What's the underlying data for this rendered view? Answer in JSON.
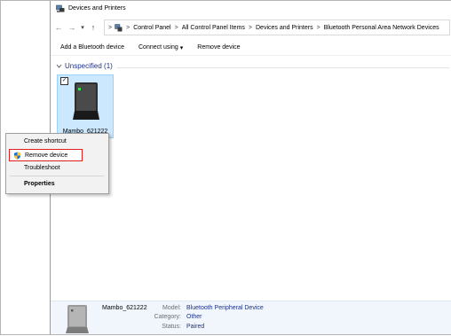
{
  "window": {
    "title": "Devices and Printers"
  },
  "address": {
    "crumbs": [
      "Control Panel",
      "All Control Panel Items",
      "Devices and Printers",
      "Bluetooth Personal Area Network Devices"
    ],
    "separator": ">"
  },
  "nav": {
    "back": "←",
    "forward": "→",
    "dropdown": "▾",
    "up": "↑",
    "crumb_arrow": ">"
  },
  "commands": {
    "add": "Add a Bluetooth device",
    "connect_using": "Connect using",
    "connect_caret": "▾",
    "remove": "Remove device"
  },
  "group": {
    "title": "Unspecified (1)",
    "chevron": "⌄"
  },
  "device": {
    "name": "Mambo_621222",
    "checked": "✓"
  },
  "context_menu": {
    "create_shortcut": "Create shortcut",
    "remove_device": "Remove device",
    "troubleshoot": "Troubleshoot",
    "properties": "Properties"
  },
  "details": {
    "name": "Mambo_621222",
    "model_label": "Model:",
    "model_value": "Bluetooth Peripheral Device",
    "category_label": "Category:",
    "category_value": "Other",
    "status_label": "Status:",
    "status_value": "Paired"
  },
  "colors": {
    "link_blue": "#1e3287",
    "selection": "#cce8ff",
    "highlight_border": "#e02020"
  }
}
